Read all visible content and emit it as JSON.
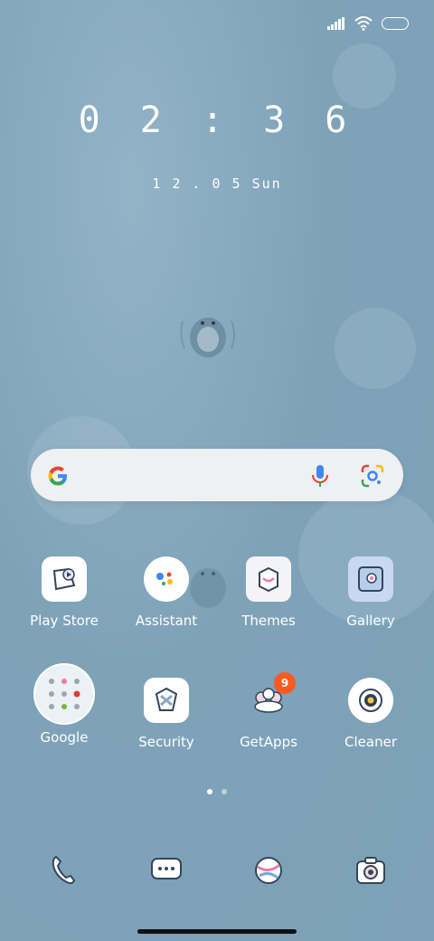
{
  "clock": {
    "time": "0 2 : 3 6",
    "date": "1 2 . 0 5  Sun"
  },
  "search": {
    "logo_icon": "google-g-icon",
    "mic_icon": "mic-icon",
    "lens_icon": "lens-icon"
  },
  "apps": [
    {
      "label": "Play Store",
      "icon": "play-store-icon"
    },
    {
      "label": "Assistant",
      "icon": "assistant-icon"
    },
    {
      "label": "Themes",
      "icon": "themes-icon"
    },
    {
      "label": "Gallery",
      "icon": "gallery-icon"
    },
    {
      "label": "Google",
      "icon": "google-folder-icon"
    },
    {
      "label": "Security",
      "icon": "security-icon"
    },
    {
      "label": "GetApps",
      "icon": "getapps-icon",
      "badge": "9"
    },
    {
      "label": "Cleaner",
      "icon": "cleaner-icon"
    }
  ],
  "dock": [
    {
      "icon": "phone-icon"
    },
    {
      "icon": "messages-icon"
    },
    {
      "icon": "browser-icon"
    },
    {
      "icon": "camera-icon"
    }
  ],
  "pager": {
    "pages": 2,
    "active": 1
  },
  "colors": {
    "accent_badge": "#ff5a1f",
    "background": "#7ca1b8"
  }
}
